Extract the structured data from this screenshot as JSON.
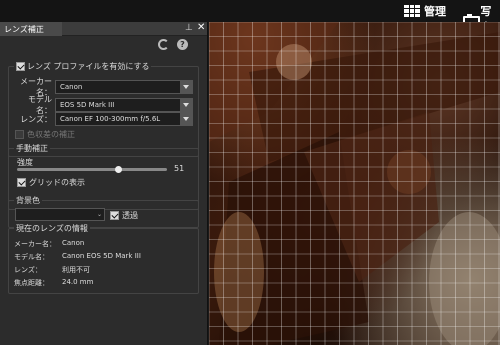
{
  "toolbar": {
    "manage_label": "管理",
    "photo_label": "写真"
  },
  "panel": {
    "tab_title": "レンズ補正",
    "profile": {
      "enable_label": "レンズ プロファイルを有効にする",
      "enabled": true,
      "maker_label": "メーカー名：",
      "maker_value": "Canon",
      "model_label": "モデル名：",
      "model_value": "EOS 5D Mark III",
      "lens_label": "レンズ：",
      "lens_value": "Canon EF 100-300mm f/5.6L",
      "chromatic_label": "色収差の補正",
      "chromatic_enabled": false
    },
    "manual": {
      "title": "手動補正",
      "strength_label": "強度",
      "strength_value": "51",
      "strength_fraction": 0.51,
      "grid_label": "グリッドの表示",
      "grid_enabled": true
    },
    "background": {
      "title": "背景色",
      "transparent_label": "透過",
      "transparent_enabled": true
    },
    "current_lens": {
      "title": "現在のレンズの情報",
      "rows": [
        {
          "k": "メーカー名：",
          "v": "Canon"
        },
        {
          "k": "モデル名：",
          "v": "Canon EOS 5D Mark III"
        },
        {
          "k": "レンズ：",
          "v": "利用不可"
        },
        {
          "k": "焦点距離：",
          "v": "24.0 mm"
        }
      ]
    }
  }
}
